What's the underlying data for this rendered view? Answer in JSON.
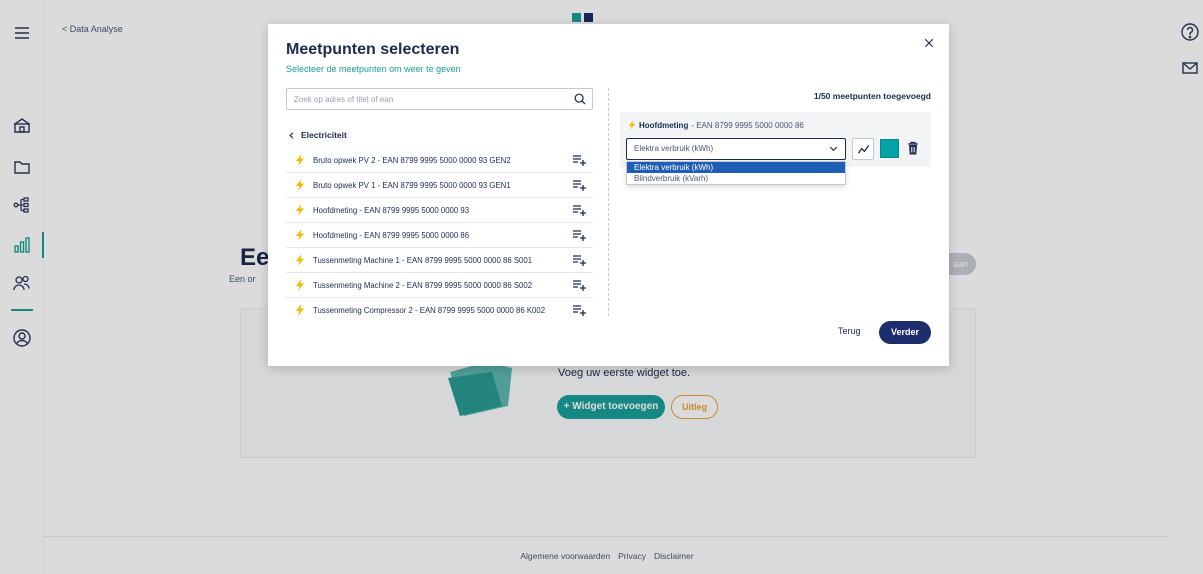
{
  "background": {
    "breadcrumb": "< Data Analyse",
    "page_title": "Een",
    "page_subtitle": "Een or",
    "pill_text": "aan",
    "empty_state_text": "Voeg uw eerste widget toe.",
    "add_widget_label": "+ Widget toevoegen",
    "uitleg_label": "Uitleg",
    "footer": {
      "links": [
        "Algemene voorwaarden",
        "Privacy",
        "Disclaimer"
      ]
    }
  },
  "modal": {
    "title": "Meetpunten selecteren",
    "subtitle": "Selecteer de meetpunten om weer te geven",
    "search_placeholder": "Zoek op adres of titel of ean",
    "category": "Electriciteit",
    "items": [
      {
        "label": "Bruto opwek PV 2 - EAN 8799 9995 5000 0000 93 GEN2"
      },
      {
        "label": "Bruto opwek PV 1 - EAN 8799 9995 5000 0000 93 GEN1"
      },
      {
        "label": "Hoofdmeting - EAN 8799 9995 5000 0000 93"
      },
      {
        "label": "Hoofdmeting - EAN 8799 9995 5000 0000 86"
      },
      {
        "label": "Tussenmeting Machine 1 - EAN 8799 9995 5000 0000 86 S001"
      },
      {
        "label": "Tussenmeting Machine 2 - EAN 8799 9995 5000 0000 86 S002"
      },
      {
        "label": "Tussenmeting Compressor 2 - EAN 8799 9995 5000 0000 86 K002"
      }
    ],
    "added_count": "1/50 meetpunten toegevoegd",
    "selected": {
      "name": "Hoofdmeting",
      "ean": "- EAN 8799 9995 5000 0000 86",
      "type_value": "Elektra verbruik (kWh)",
      "color": "#00a4a6",
      "options": [
        "Elektra verbruik (kWh)",
        "Blindverbruik (kVarh)"
      ]
    },
    "terug_label": "Terug",
    "verder_label": "Verder"
  },
  "colors": {
    "accent": "#1a9f9a",
    "primary": "#1d2d6e",
    "bolt": "#f5b800",
    "dropdown_highlight": "#1f5eb5"
  }
}
